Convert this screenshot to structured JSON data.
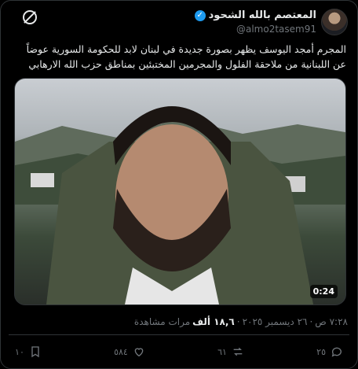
{
  "author": {
    "display_name": "المعتصم بالله الشحود",
    "handle": "@almo2tasem91",
    "verified_mark": "✓"
  },
  "tweet": {
    "line1": "المجرم  أمجد اليوسف يظهر بصورة جديدة في لبنان لابد للحكومة السورية عوضاً",
    "line2": "عن اللبنانية من ملاحقة الفلول والمجرمين المختبئين بمناطق حزب الله الارهابي"
  },
  "media": {
    "duration": "0:24"
  },
  "meta": {
    "time": "٧:٢٨ ص",
    "sep1": "·",
    "date": "٢٦ ديسمبر ٢٠٢٥",
    "sep2": "·",
    "views_count": "١٨,٦ ألف",
    "views_label": "مرات مشاهدة"
  },
  "actions": {
    "replies": "٢٥",
    "reposts": "٦١",
    "likes": "٥٨٤",
    "bookmarks": "١٠"
  },
  "icons": {
    "grok": "grok-icon",
    "reply": "reply-icon",
    "repost": "repost-icon",
    "like": "heart-icon",
    "bookmark": "bookmark-icon"
  },
  "colors": {
    "background": "#000000",
    "text": "#e7e9ea",
    "muted": "#71767b",
    "verified": "#1d9bf0",
    "border": "#2f3336"
  }
}
